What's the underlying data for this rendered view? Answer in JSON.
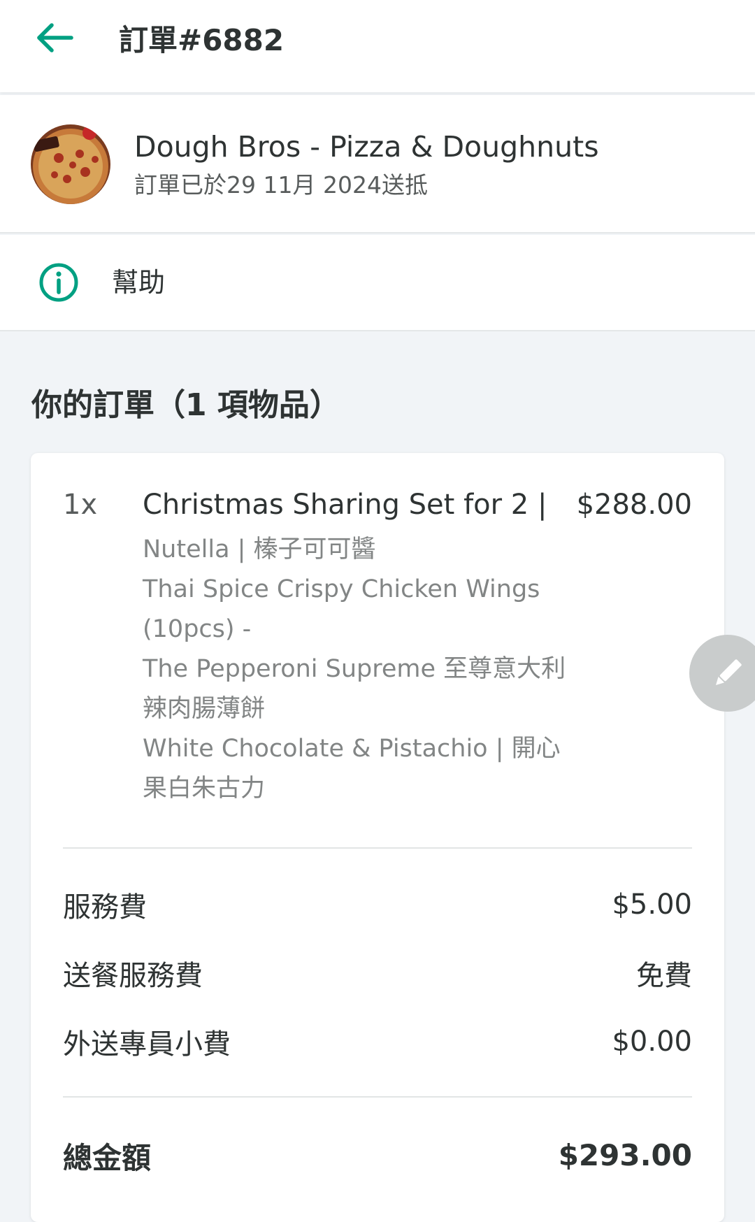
{
  "header": {
    "title": "訂單#6882",
    "back_icon": "arrow-left-icon",
    "accent_color": "#00a082"
  },
  "restaurant": {
    "name": "Dough Bros - Pizza & Doughnuts",
    "status": "訂單已於29 11月 2024送抵",
    "logo_icon": "pizza-logo"
  },
  "help": {
    "label": "幫助",
    "icon": "info-circle-icon"
  },
  "order": {
    "heading": "你的訂單（1 項物品）",
    "items": [
      {
        "quantity": "1x",
        "name": "Christmas Sharing Set for 2 |",
        "price": "$288.00",
        "options": [
          "Nutella | 榛子可可醬",
          "Thai Spice Crispy Chicken Wings (10pcs) -",
          "The Pepperoni Supreme 至尊意大利辣肉腸薄餅",
          "White Chocolate & Pistachio | 開心果白朱古力"
        ]
      }
    ],
    "fees": [
      {
        "label": "服務費",
        "value": "$5.00"
      },
      {
        "label": "送餐服務費",
        "value": "免費"
      },
      {
        "label": "外送專員小費",
        "value": "$0.00"
      }
    ],
    "total": {
      "label": "總金額",
      "value": "$293.00"
    }
  },
  "edit_button": {
    "icon": "pencil-icon"
  }
}
